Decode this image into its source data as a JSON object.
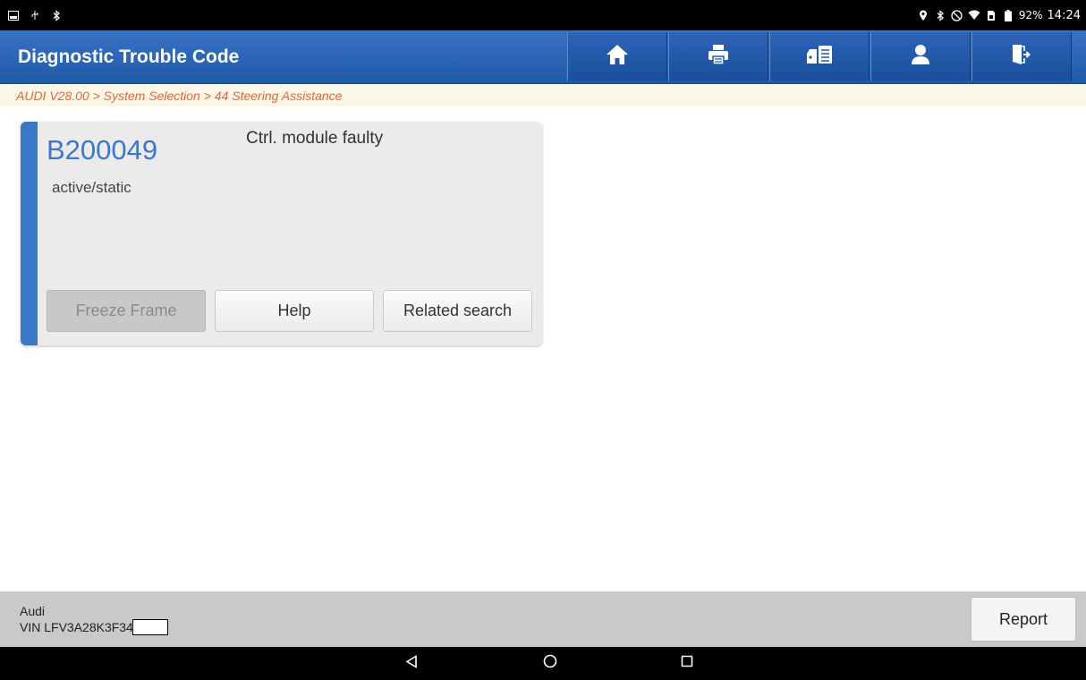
{
  "status_bar": {
    "left_icons": [
      "image-icon",
      "usb-icon",
      "bluetooth-icon"
    ],
    "right_icons": [
      "location-icon",
      "bluetooth-icon",
      "do-not-disturb-icon",
      "wifi-icon",
      "sim-icon",
      "battery-icon"
    ],
    "battery": "92%",
    "time": "14:24"
  },
  "header": {
    "title": "Diagnostic Trouble Code",
    "toolbar": [
      {
        "icon": "home-icon"
      },
      {
        "icon": "print-icon"
      },
      {
        "icon": "vehicle-report-icon"
      },
      {
        "icon": "user-icon"
      },
      {
        "icon": "exit-icon"
      }
    ]
  },
  "breadcrumb": "AUDI V28.00 > System Selection > 44 Steering Assistance",
  "dtc": {
    "code": "B200049",
    "description": "Ctrl. module faulty",
    "status": "active/static",
    "buttons": {
      "freeze_frame": "Freeze Frame",
      "help": "Help",
      "related_search": "Related search"
    }
  },
  "footer": {
    "make": "Audi",
    "vin": "VIN LFV3A28K3F34",
    "report_label": "Report"
  },
  "nav": {
    "icons": [
      "back-icon",
      "home-circle-icon",
      "recents-icon"
    ]
  },
  "colors": {
    "accent": "#3b78c9",
    "breadcrumb_text": "#e8633a",
    "header_bg": "#2a63b4"
  }
}
